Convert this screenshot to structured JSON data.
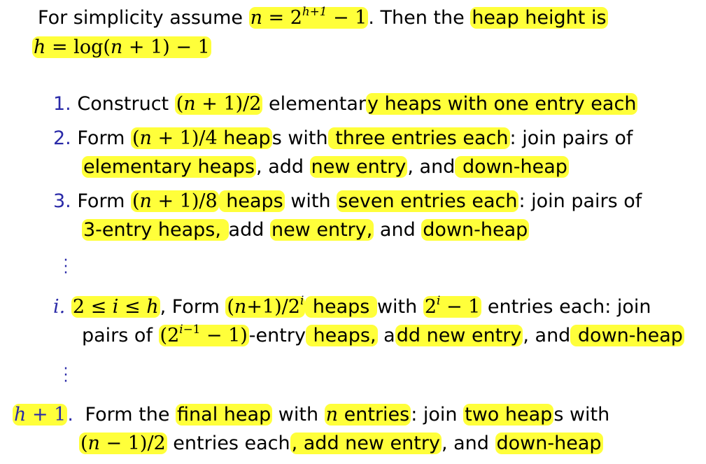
{
  "intro": {
    "l1": {
      "a": "For simplicity assume ",
      "b": "n = 2",
      "bsup": "h+1",
      "c": " − 1",
      "d": ". Then the ",
      "e": "heap height is"
    },
    "l2": {
      "a": "h = log(n + 1) − 1"
    }
  },
  "steps": [
    {
      "number": "1.",
      "l1": {
        "a": "Construct ",
        "b": "(n + 1)/2",
        "c": " elementar",
        "d": "y heaps with one entry each"
      }
    },
    {
      "number": "2.",
      "l1": {
        "a": "Form ",
        "b": "(n + 1)/4 heap",
        "c": "s with",
        "d": " three entries each",
        "e": ": join pairs of"
      },
      "l2": {
        "a": "elementary heaps",
        "b": ", add ",
        "c": "new entry",
        "d": ", and",
        "e": " down-heap"
      }
    },
    {
      "number": "3.",
      "l1": {
        "a": "Form ",
        "b": "(n + 1)/8",
        "c": " heaps",
        "d": " with ",
        "e": "seven entries each",
        "f": ": join pairs of"
      },
      "l2": {
        "a": "3-entry heaps, ",
        "b": "add ",
        "c": "new entry,",
        "d": " and ",
        "e": "down-heap"
      }
    },
    {
      "number": "i.",
      "l1": {
        "a": "2 ≤ i ≤ h",
        "b": ", Form ",
        "c": "(n+1)/2",
        "csup": "i",
        "d": " heaps ",
        "e": "with ",
        "f": "2",
        "fsup": "i",
        "g": " − 1",
        "h": " entries each: join"
      },
      "l2": {
        "a": "pairs of ",
        "b": "(2",
        "bsup": "i−1",
        "c": " − 1)",
        "d": "-entry",
        "e": " heaps,",
        "f": " a",
        "g": "dd new entry",
        "h": ", and",
        "k": " down-heap"
      }
    },
    {
      "number": "h + 1",
      "numdot": ".",
      "l1": {
        "a": "Form the ",
        "b": "final heap",
        "c": " with ",
        "d": "n",
        "e": " entries",
        "f": ": join ",
        "g": "two heap",
        "h": "s with"
      },
      "l2": {
        "a": "(n − 1)/2",
        "b": " entries each",
        "c": ", add new entry",
        "d": ", and ",
        "e": "down-heap"
      }
    }
  ],
  "ellipsis": "⋮",
  "highlight_color": "#ffff3a",
  "number_color": "#2a2aa8"
}
